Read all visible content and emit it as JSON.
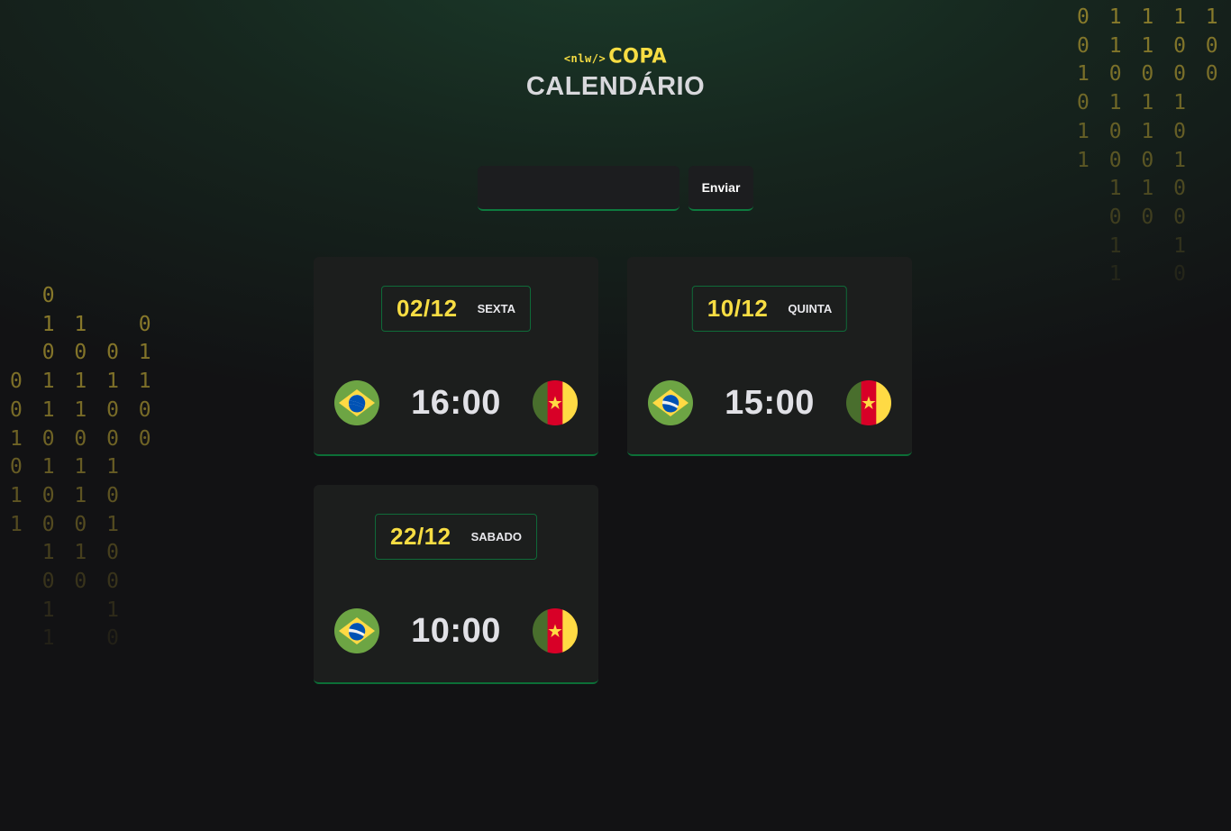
{
  "logo": {
    "tag": "<nlw/>",
    "word": "COPA"
  },
  "page": {
    "title": "CALENDÁRIO"
  },
  "search": {
    "value": "",
    "placeholder": "",
    "button_label": "Enviar"
  },
  "matches": [
    {
      "date": "02/12",
      "weekday": "SEXTA",
      "time": "16:00",
      "home_flag": "brazil-flag-icon",
      "away_flag": "cameroon-flag-icon"
    },
    {
      "date": "10/12",
      "weekday": "QUINTA",
      "time": "15:00",
      "home_flag": "brazil-flag-icon",
      "away_flag": "cameroon-flag-icon"
    },
    {
      "date": "22/12",
      "weekday": "SABADO",
      "time": "10:00",
      "home_flag": "brazil-flag-icon",
      "away_flag": "cameroon-flag-icon"
    }
  ],
  "decoration": {
    "binary_right": [
      "0 1 1 1 1",
      "0 1 1 0 0",
      "1 0 0 0 0",
      "0 1 1 1",
      "1 0 1 0",
      "1 0 0 1",
      "  1 1 0",
      "  0 0 0",
      "  1   1",
      "  1   0"
    ],
    "binary_left": [
      "  0",
      "  1 1   0",
      "  0 0 0 1",
      "0 1 1 1 1",
      "0 1 1 0 0",
      "1 0 0 0 0",
      "0 1 1 1",
      "1 0 1 0",
      "1 0 0 1",
      "  1 1 0",
      "  0 0 0",
      "  1   1",
      "  1   0"
    ]
  },
  "colors": {
    "background": "#121214",
    "accent_yellow": "#f7dd43",
    "accent_green": "#0e7a3e",
    "card": "#1c1e1d"
  }
}
